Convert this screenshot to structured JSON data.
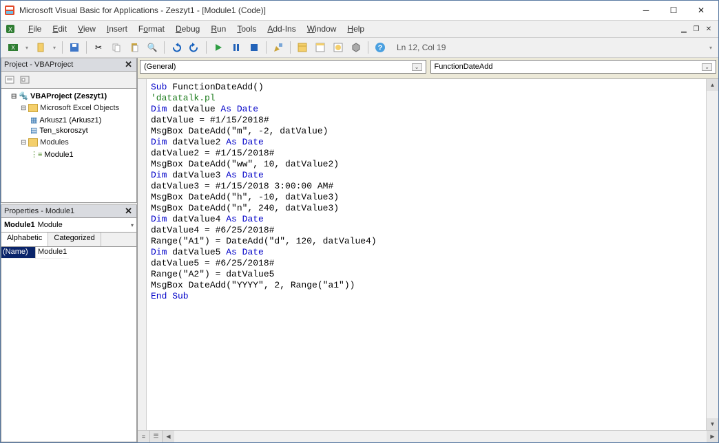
{
  "window": {
    "title": "Microsoft Visual Basic for Applications - Zeszyt1 - [Module1 (Code)]"
  },
  "menu": {
    "items": [
      "File",
      "Edit",
      "View",
      "Insert",
      "Format",
      "Debug",
      "Run",
      "Tools",
      "Add-Ins",
      "Window",
      "Help"
    ]
  },
  "toolbar": {
    "status": "Ln 12, Col 19"
  },
  "project_panel": {
    "title": "Project - VBAProject",
    "tree": {
      "root": "VBAProject (Zeszyt1)",
      "folders": [
        {
          "label": "Microsoft Excel Objects",
          "items": [
            "Arkusz1 (Arkusz1)",
            "Ten_skoroszyt"
          ]
        },
        {
          "label": "Modules",
          "items": [
            "Module1"
          ]
        }
      ]
    }
  },
  "props_panel": {
    "title": "Properties - Module1",
    "object_name": "Module1",
    "object_type": "Module",
    "tabs": [
      "Alphabetic",
      "Categorized"
    ],
    "active_tab": 0,
    "rows": [
      {
        "k": "(Name)",
        "v": "Module1"
      }
    ]
  },
  "code_panel": {
    "left_combo": "(General)",
    "right_combo": "FunctionDateAdd",
    "lines": [
      {
        "t": [
          {
            "c": "kw",
            "s": "Sub"
          },
          {
            "c": "",
            "s": " FunctionDateAdd()"
          }
        ]
      },
      {
        "t": [
          {
            "c": "",
            "s": ""
          }
        ]
      },
      {
        "t": [
          {
            "c": "cm",
            "s": "'datatalk.pl"
          }
        ]
      },
      {
        "t": [
          {
            "c": "kw",
            "s": "Dim"
          },
          {
            "c": "",
            "s": " datValue "
          },
          {
            "c": "kw",
            "s": "As Date"
          }
        ]
      },
      {
        "t": [
          {
            "c": "",
            "s": "datValue = #1/15/2018#"
          }
        ]
      },
      {
        "t": [
          {
            "c": "",
            "s": "MsgBox DateAdd(\"m\", -2, datValue)"
          }
        ]
      },
      {
        "t": [
          {
            "c": "",
            "s": ""
          }
        ]
      },
      {
        "t": [
          {
            "c": "kw",
            "s": "Dim"
          },
          {
            "c": "",
            "s": " datValue2 "
          },
          {
            "c": "kw",
            "s": "As Date"
          }
        ]
      },
      {
        "t": [
          {
            "c": "",
            "s": "datValue2 = #1/15/2018#"
          }
        ]
      },
      {
        "t": [
          {
            "c": "",
            "s": "MsgBox DateAdd(\"ww\", 10, datValue2)"
          }
        ]
      },
      {
        "t": [
          {
            "c": "",
            "s": ""
          }
        ]
      },
      {
        "t": [
          {
            "c": "kw",
            "s": "Dim"
          },
          {
            "c": "",
            "s": " datValue3 "
          },
          {
            "c": "kw",
            "s": "As Date"
          }
        ]
      },
      {
        "t": [
          {
            "c": "",
            "s": "datValue3 = #1/15/2018 3:00:00 AM#"
          }
        ]
      },
      {
        "t": [
          {
            "c": "",
            "s": "MsgBox DateAdd(\"h\", -10, datValue3)"
          }
        ]
      },
      {
        "t": [
          {
            "c": "",
            "s": "MsgBox DateAdd(\"n\", 240, datValue3)"
          }
        ]
      },
      {
        "t": [
          {
            "c": "",
            "s": ""
          }
        ]
      },
      {
        "t": [
          {
            "c": "kw",
            "s": "Dim"
          },
          {
            "c": "",
            "s": " datValue4 "
          },
          {
            "c": "kw",
            "s": "As Date"
          }
        ]
      },
      {
        "t": [
          {
            "c": "",
            "s": "datValue4 = #6/25/2018#"
          }
        ]
      },
      {
        "t": [
          {
            "c": "",
            "s": "Range(\"A1\") = DateAdd(\"d\", 120, datValue4)"
          }
        ]
      },
      {
        "t": [
          {
            "c": "",
            "s": ""
          }
        ]
      },
      {
        "t": [
          {
            "c": "kw",
            "s": "Dim"
          },
          {
            "c": "",
            "s": " datValue5 "
          },
          {
            "c": "kw",
            "s": "As Date"
          }
        ]
      },
      {
        "t": [
          {
            "c": "",
            "s": "datValue5 = #6/25/2018#"
          }
        ]
      },
      {
        "t": [
          {
            "c": "",
            "s": "Range(\"A2\") = datValue5"
          }
        ]
      },
      {
        "t": [
          {
            "c": "",
            "s": "MsgBox DateAdd(\"YYYY\", 2, Range(\"a1\"))"
          }
        ]
      },
      {
        "t": [
          {
            "c": "",
            "s": ""
          }
        ]
      },
      {
        "t": [
          {
            "c": "kw",
            "s": "End Sub"
          }
        ]
      }
    ]
  }
}
